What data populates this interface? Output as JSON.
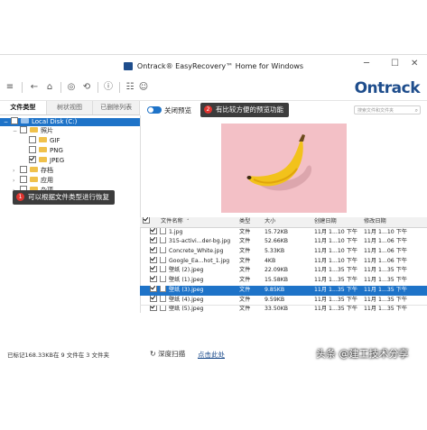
{
  "window": {
    "title": "Ontrack® EasyRecovery™ Home for Windows",
    "controls": [
      "─",
      "☐",
      "✕"
    ]
  },
  "toolbar": {
    "icons": [
      "menu-icon",
      "back-icon",
      "home-icon",
      "scan-icon",
      "recover-icon",
      "info-icon",
      "cart-icon",
      "user-icon"
    ],
    "glyphs": [
      "≡",
      "←",
      "⌂",
      "◎",
      "⟲",
      "ⓘ",
      "☷",
      "☺"
    ],
    "logo": "Ontrack"
  },
  "tabs": [
    {
      "label": "文件类型",
      "active": true
    },
    {
      "label": "树状视图",
      "active": false
    },
    {
      "label": "已删除列表",
      "active": false
    }
  ],
  "tree": [
    {
      "label": "Local Disk (C:)",
      "level": 0,
      "toggle": "−",
      "checked": false,
      "selected": true
    },
    {
      "label": "照片",
      "level": 1,
      "toggle": "−",
      "checked": false,
      "selected": false
    },
    {
      "label": "GIF",
      "level": 2,
      "toggle": "",
      "checked": false,
      "selected": false
    },
    {
      "label": "PNG",
      "level": 2,
      "toggle": "",
      "checked": false,
      "selected": false
    },
    {
      "label": "JPEG",
      "level": 2,
      "toggle": "",
      "checked": true,
      "selected": false
    },
    {
      "label": "存档",
      "level": 1,
      "toggle": "›",
      "checked": false,
      "selected": false
    },
    {
      "label": "应用",
      "level": 1,
      "toggle": "›",
      "checked": false,
      "selected": false
    },
    {
      "label": "杂项",
      "level": 1,
      "toggle": "›",
      "checked": false,
      "selected": false
    }
  ],
  "callouts": {
    "left": {
      "num": "1",
      "text": "可以根据文件类型进行恢复"
    },
    "right": {
      "num": "2",
      "text": "有比较方便的预览功能"
    }
  },
  "preview": {
    "toggle_label": "关闭预览",
    "search_placeholder": "搜索文件和文件夹"
  },
  "table": {
    "headers": [
      "文件名称",
      "类型",
      "大小",
      "创建日期",
      "修改日期"
    ],
    "rows": [
      {
        "name": "1.jpg",
        "type": "文件",
        "size": "15.72KB",
        "created": "11月 1...10 下午",
        "modified": "11月 1...10 下午",
        "selected": false
      },
      {
        "name": "315-activi...der-bg.jpg",
        "type": "文件",
        "size": "52.66KB",
        "created": "11月 1...10 下午",
        "modified": "11月 1...06 下午",
        "selected": false
      },
      {
        "name": "Concrete_White.jpg",
        "type": "文件",
        "size": "5.33KB",
        "created": "11月 1...10 下午",
        "modified": "11月 1...06 下午",
        "selected": false
      },
      {
        "name": "Google_Ea...hot_1.jpg",
        "type": "文件",
        "size": "4KB",
        "created": "11月 1...10 下午",
        "modified": "11月 1...06 下午",
        "selected": false
      },
      {
        "name": "壁纸 (2).jpeg",
        "type": "文件",
        "size": "22.09KB",
        "created": "11月 1...35 下午",
        "modified": "11月 1...35 下午",
        "selected": false
      },
      {
        "name": "壁纸 (1).jpeg",
        "type": "文件",
        "size": "15.58KB",
        "created": "11月 1...35 下午",
        "modified": "11月 1...35 下午",
        "selected": false
      },
      {
        "name": "壁纸 (3).jpeg",
        "type": "文件",
        "size": "9.85KB",
        "created": "11月 1...35 下午",
        "modified": "11月 1...35 下午",
        "selected": true
      },
      {
        "name": "壁纸 (4).jpeg",
        "type": "文件",
        "size": "9.59KB",
        "created": "11月 1...35 下午",
        "modified": "11月 1...35 下午",
        "selected": false
      },
      {
        "name": "壁纸 (5).jpeg",
        "type": "文件",
        "size": "33.50KB",
        "created": "11月 1...35 下午",
        "modified": "11月 1...35 下午",
        "selected": false
      }
    ]
  },
  "status": {
    "text": "已标记168.33KB在 9 文件在 3 文件夹",
    "deep_scan_label": "深度扫描",
    "click_here": "点击此处"
  },
  "watermark": "头条 @建工技术分享",
  "colors": {
    "accent": "#1e73c8",
    "brand": "#1e4d8c",
    "preview_bg": "#f3c0c6",
    "banana": "#f2c21b"
  }
}
